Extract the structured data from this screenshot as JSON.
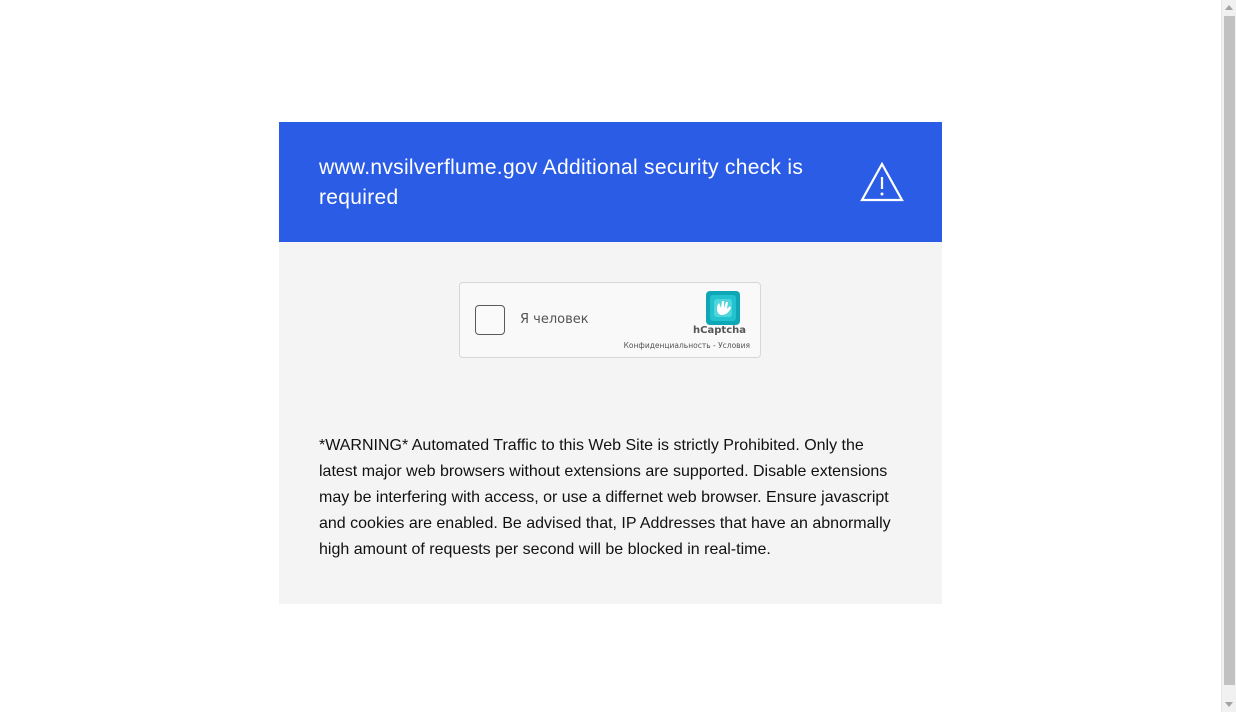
{
  "banner": {
    "title": "www.nvsilverflume.gov Additional security check is required",
    "icon": "warning-triangle-icon",
    "background_color": "#2b5ce6"
  },
  "captcha": {
    "label": "Я человек",
    "brand": "hCaptcha",
    "privacy_link": "Конфиденциальность",
    "separator": " - ",
    "terms_link": "Условия",
    "checked": false
  },
  "notice": {
    "text": "*WARNING* Automated Traffic to this Web Site is strictly Prohibited. Only the latest major web browsers without extensions are supported. Disable extensions may be interfering with access, or use a differnet web browser. Ensure javascript and cookies are enabled. Be advised that, IP Addresses that have an abnormally high amount of requests per second will be blocked in real-time."
  }
}
